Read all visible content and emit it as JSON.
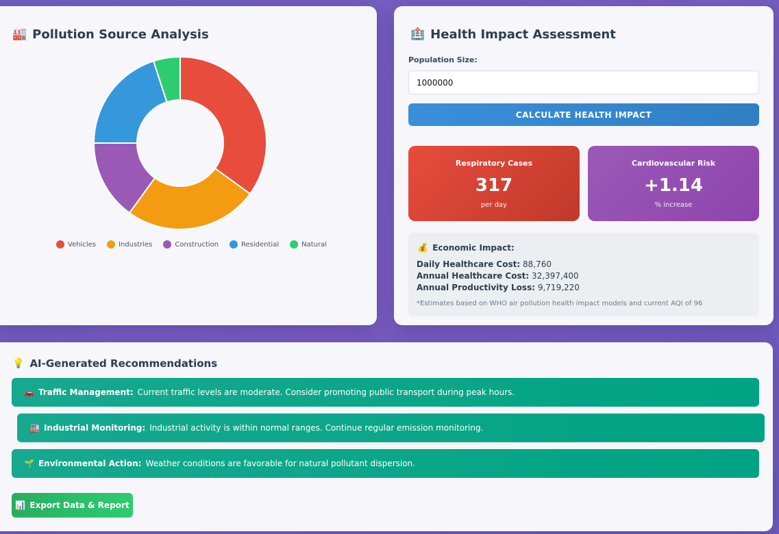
{
  "pollution": {
    "title": "Pollution Source Analysis",
    "icon": "factory-icon",
    "icon_glyph": "🏭"
  },
  "chart_data": {
    "type": "pie",
    "categories": [
      "Vehicles",
      "Industries",
      "Construction",
      "Residential",
      "Natural"
    ],
    "values": [
      35,
      25,
      15,
      20,
      5
    ],
    "colors": [
      "#e74c3c",
      "#f39c12",
      "#9b59b6",
      "#3498db",
      "#2ecc71"
    ],
    "legend_position": "bottom",
    "donut": true
  },
  "health": {
    "title": "Health Impact Assessment",
    "icon": "hospital-icon",
    "icon_glyph": "🏥",
    "population_label": "Population Size:",
    "population_value": "1000000",
    "calculate_label": "CALCULATE HEALTH IMPACT",
    "respiratory": {
      "label": "Respiratory Cases",
      "value": "317",
      "unit": "per day"
    },
    "cardio": {
      "label": "Cardiovascular Risk",
      "value": "+1.14",
      "unit": "% increase"
    },
    "economic": {
      "icon_glyph": "💰",
      "title": "Economic Impact:",
      "daily_label": "Daily Healthcare Cost:",
      "daily_value": "88,760",
      "annual_label": "Annual Healthcare Cost:",
      "annual_value": "32,397,400",
      "productivity_label": "Annual Productivity Loss:",
      "productivity_value": "9,719,220",
      "note": "*Estimates based on WHO air pollution health impact models and current AQI of 96"
    }
  },
  "ai": {
    "title": "AI-Generated Recommendations",
    "icon_glyph": "💡",
    "recommendations": [
      {
        "icon_glyph": "🚗",
        "title": "Traffic Management:",
        "text": "Current traffic levels are moderate. Consider promoting public transport during peak hours."
      },
      {
        "icon_glyph": "🏭",
        "title": "Industrial Monitoring:",
        "text": "Industrial activity is within normal ranges. Continue regular emission monitoring."
      },
      {
        "icon_glyph": "🌱",
        "title": "Environmental Action:",
        "text": "Weather conditions are favorable for natural pollutant dispersion."
      }
    ],
    "export_icon_glyph": "📊",
    "export_label": "Export Data & Report"
  }
}
